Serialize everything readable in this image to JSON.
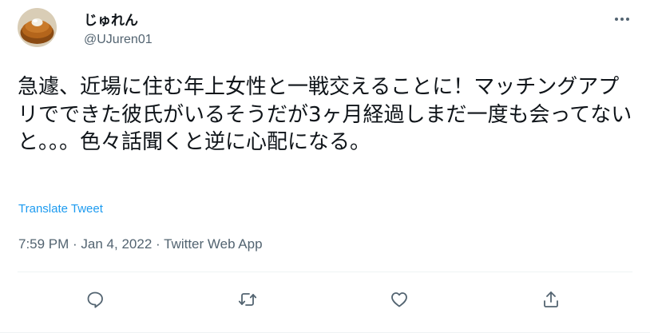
{
  "author": {
    "display_name": "じゅれん",
    "handle": "@UJuren01",
    "avatar_icon": "avatar-dessert-photo"
  },
  "tweet": {
    "text": "急遽、近場に住む年上女性と一戦交えることに！マッチングアプリでできた彼氏がいるそうだが3ヶ月経過しまだ一度も会ってないと。。。色々話聞くと逆に心配になる。",
    "translate_label": "Translate Tweet",
    "time": "7:59 PM",
    "date": "Jan 4, 2022",
    "source": "Twitter Web App",
    "separator": " · "
  },
  "icons": {
    "more": "more-icon",
    "reply": "reply-icon",
    "retweet": "retweet-icon",
    "like": "like-icon",
    "share": "share-icon"
  },
  "colors": {
    "text": "#0f1419",
    "secondary": "#536471",
    "link": "#1d9bf0",
    "divider": "#eff3f4"
  }
}
